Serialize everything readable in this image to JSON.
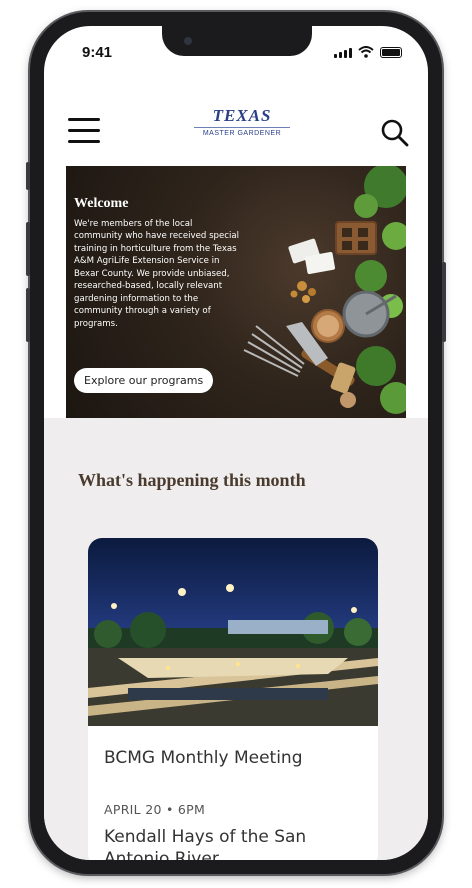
{
  "status_bar": {
    "time": "9:41"
  },
  "header": {
    "logo_top": "TEXAS",
    "logo_bottom": "MASTER GARDENER",
    "menu_icon": "hamburger-menu-icon",
    "search_icon": "search-icon"
  },
  "hero": {
    "title": "Welcome",
    "body": "We're members of the local community who have received special training in horticulture from the Texas A&M AgriLife Extension Service in Bexar County. We provide unbiased, researched-based, locally relevant gardening information to the community through a variety of programs.",
    "cta_label": "Explore our programs"
  },
  "events": {
    "section_title": "What's happening this month",
    "card": {
      "title": "BCMG Monthly Meeting",
      "date": "APRIL 20 • 6PM",
      "subtitle": "Kendall Hays of the San Antonio River"
    }
  },
  "colors": {
    "brand_blue": "#2a3f86",
    "section_title": "#4a3b2e",
    "section_bg": "#efeded",
    "soil_dark": "#2e241b"
  }
}
